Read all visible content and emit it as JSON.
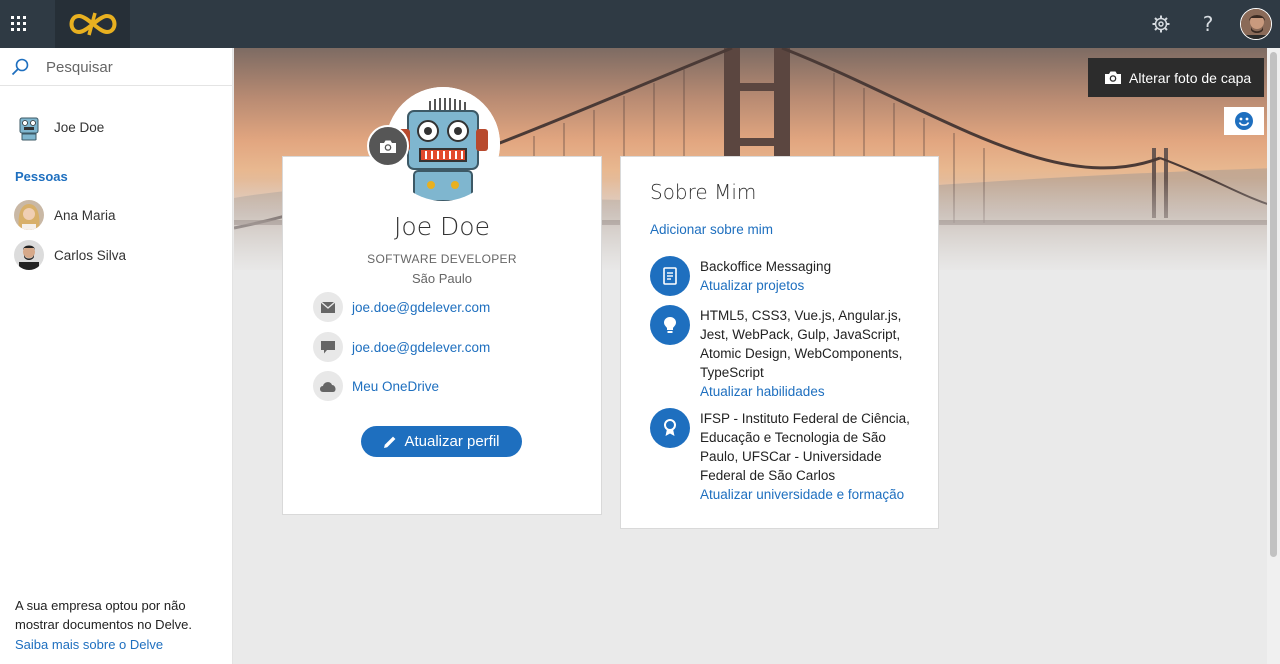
{
  "topbar": {
    "app_launcher_icon": "waffle-icon",
    "logo_icon": "infinity-logo",
    "settings_icon": "gear-icon",
    "help_label": "?",
    "avatar_icon": "user-avatar"
  },
  "sidebar": {
    "search": {
      "placeholder": "Pesquisar",
      "value": ""
    },
    "me": {
      "name": "Joe Doe"
    },
    "people_heading": "Pessoas",
    "people": [
      {
        "name": "Ana Maria"
      },
      {
        "name": "Carlos Silva"
      }
    ],
    "footer": {
      "text": "A sua empresa optou por não mostrar documentos no Delve.",
      "link": "Saiba mais sobre o Delve"
    }
  },
  "cover": {
    "change_label": "Alterar foto de capa"
  },
  "profile": {
    "name": "Joe Doe",
    "job_title": "SOFTWARE DEVELOPER",
    "city": "São Paulo",
    "email": "joe.doe@gdelever.com",
    "chat": "joe.doe@gdelever.com",
    "onedrive": "Meu OneDrive",
    "update_label": "Atualizar perfil"
  },
  "about": {
    "title": "Sobre Mim",
    "add_label": "Adicionar sobre mim",
    "items": [
      {
        "icon": "notebook-icon",
        "text": "Backoffice Messaging",
        "link": "Atualizar projetos"
      },
      {
        "icon": "lightbulb-icon",
        "text": "HTML5, CSS3, Vue.js, Angular.js, Jest, WebPack, Gulp, JavaScript, Atomic Design, WebComponents, TypeScript",
        "link": "Atualizar habilidades"
      },
      {
        "icon": "ribbon-icon",
        "text": "IFSP - Instituto Federal de Ciência, Educação e Tecnologia de São Paulo, UFSCar - Universidade Federal de São Carlos",
        "link": "Atualizar universidade e formação"
      }
    ]
  },
  "colors": {
    "topbar": "#2f3a44",
    "accent": "#1e6fbf",
    "logo": "#e8b020"
  }
}
